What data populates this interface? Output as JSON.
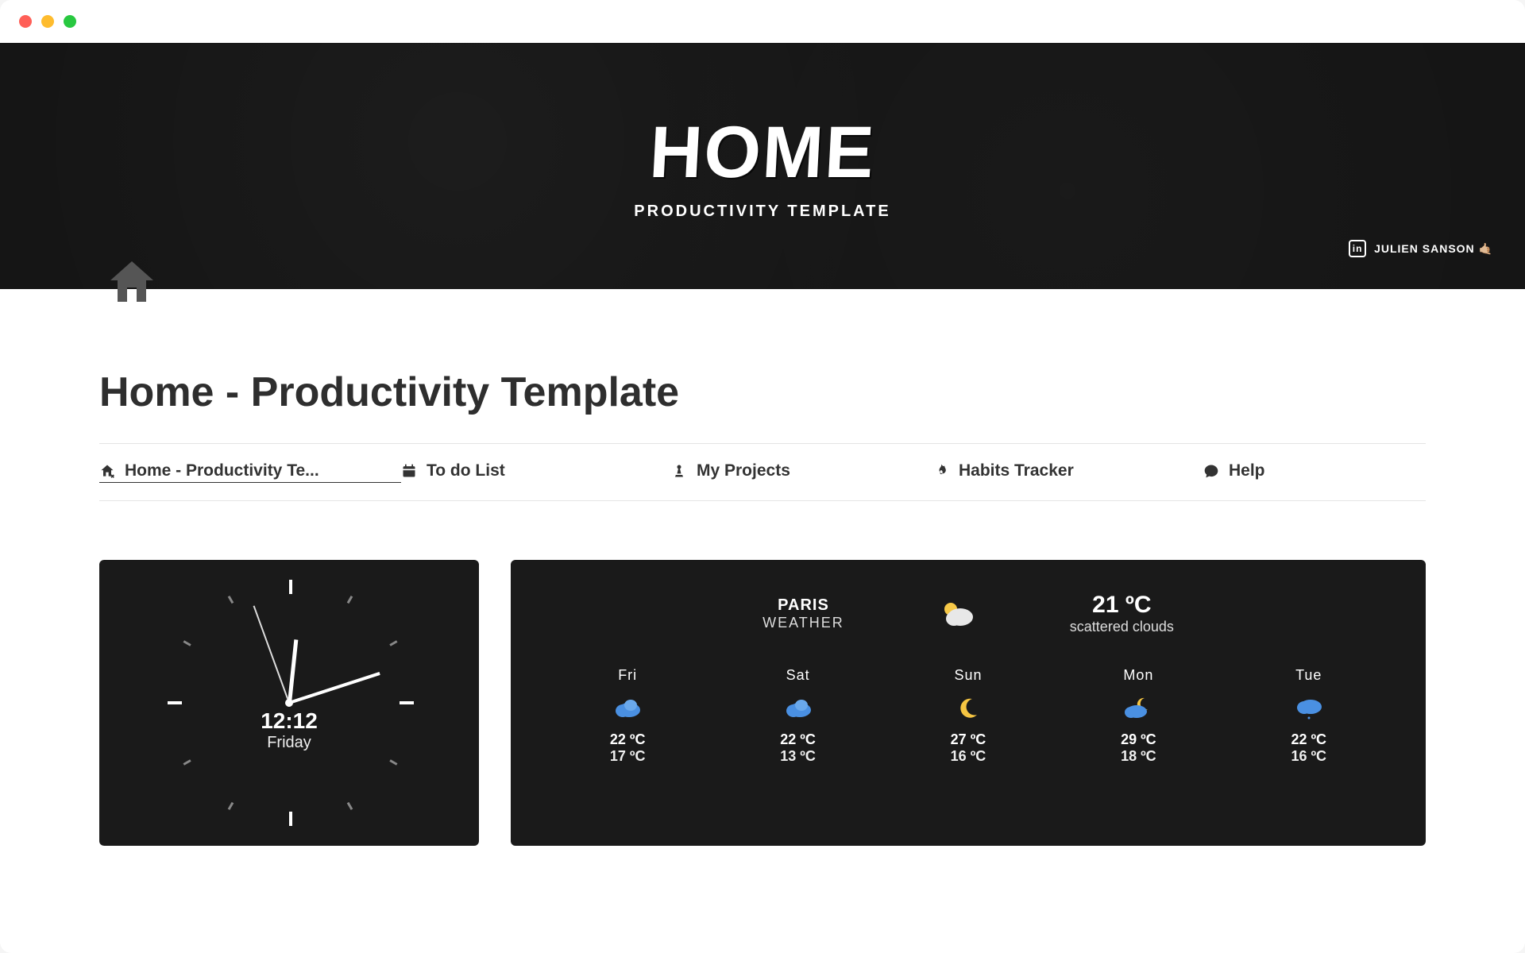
{
  "banner": {
    "title": "HOME",
    "subtitle": "PRODUCTIVITY TEMPLATE",
    "credit": "JULIEN SANSON 🤙🏼"
  },
  "page": {
    "title": "Home - Productivity Template"
  },
  "nav": {
    "items": [
      {
        "label": "Home - Productivity Te...",
        "icon": "home-share-icon"
      },
      {
        "label": "To do List",
        "icon": "calendar-icon"
      },
      {
        "label": "My Projects",
        "icon": "chess-piece-icon"
      },
      {
        "label": "Habits Tracker",
        "icon": "flame-icon"
      },
      {
        "label": "Help",
        "icon": "chat-icon"
      }
    ]
  },
  "clock": {
    "time": "12:12",
    "day": "Friday"
  },
  "weather": {
    "city": "PARIS",
    "label": "WEATHER",
    "current_temp": "21 ºC",
    "current_cond": "scattered clouds",
    "current_icon": "sun-cloud-icon",
    "forecast": [
      {
        "day": "Fri",
        "icon": "cloud-icon",
        "hi": "22 ºC",
        "lo": "17 ºC"
      },
      {
        "day": "Sat",
        "icon": "cloud-icon",
        "hi": "22 ºC",
        "lo": "13 ºC"
      },
      {
        "day": "Sun",
        "icon": "moon-icon",
        "hi": "27 ºC",
        "lo": "16 ºC"
      },
      {
        "day": "Mon",
        "icon": "moon-cloud-icon",
        "hi": "29 ºC",
        "lo": "18 ºC"
      },
      {
        "day": "Tue",
        "icon": "cloud-rain-icon",
        "hi": "22 ºC",
        "lo": "16 ºC"
      }
    ]
  }
}
